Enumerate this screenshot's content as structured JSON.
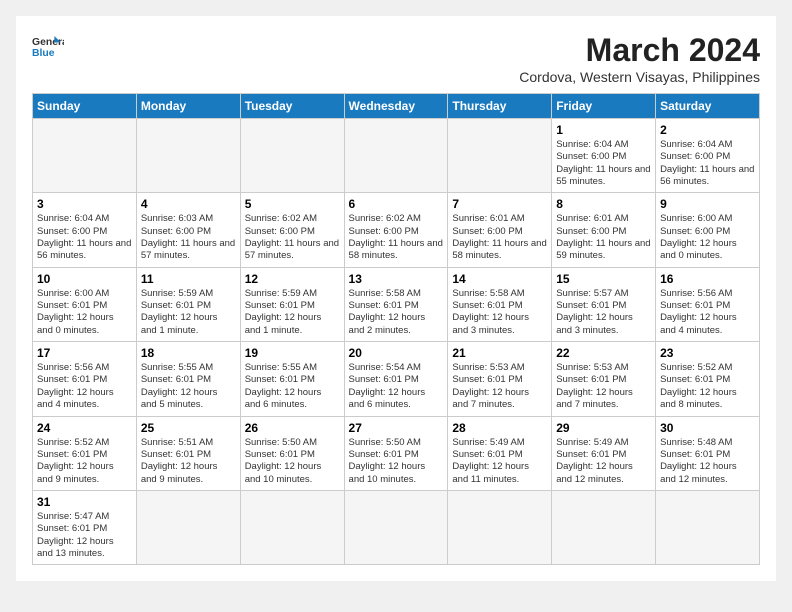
{
  "logo": {
    "line1": "General",
    "line2": "Blue"
  },
  "title": "March 2024",
  "subtitle": "Cordova, Western Visayas, Philippines",
  "weekdays": [
    "Sunday",
    "Monday",
    "Tuesday",
    "Wednesday",
    "Thursday",
    "Friday",
    "Saturday"
  ],
  "weeks": [
    [
      {
        "day": "",
        "info": ""
      },
      {
        "day": "",
        "info": ""
      },
      {
        "day": "",
        "info": ""
      },
      {
        "day": "",
        "info": ""
      },
      {
        "day": "",
        "info": ""
      },
      {
        "day": "1",
        "info": "Sunrise: 6:04 AM\nSunset: 6:00 PM\nDaylight: 11 hours and 55 minutes."
      },
      {
        "day": "2",
        "info": "Sunrise: 6:04 AM\nSunset: 6:00 PM\nDaylight: 11 hours and 56 minutes."
      }
    ],
    [
      {
        "day": "3",
        "info": "Sunrise: 6:04 AM\nSunset: 6:00 PM\nDaylight: 11 hours and 56 minutes."
      },
      {
        "day": "4",
        "info": "Sunrise: 6:03 AM\nSunset: 6:00 PM\nDaylight: 11 hours and 57 minutes."
      },
      {
        "day": "5",
        "info": "Sunrise: 6:02 AM\nSunset: 6:00 PM\nDaylight: 11 hours and 57 minutes."
      },
      {
        "day": "6",
        "info": "Sunrise: 6:02 AM\nSunset: 6:00 PM\nDaylight: 11 hours and 58 minutes."
      },
      {
        "day": "7",
        "info": "Sunrise: 6:01 AM\nSunset: 6:00 PM\nDaylight: 11 hours and 58 minutes."
      },
      {
        "day": "8",
        "info": "Sunrise: 6:01 AM\nSunset: 6:00 PM\nDaylight: 11 hours and 59 minutes."
      },
      {
        "day": "9",
        "info": "Sunrise: 6:00 AM\nSunset: 6:00 PM\nDaylight: 12 hours and 0 minutes."
      }
    ],
    [
      {
        "day": "10",
        "info": "Sunrise: 6:00 AM\nSunset: 6:01 PM\nDaylight: 12 hours and 0 minutes."
      },
      {
        "day": "11",
        "info": "Sunrise: 5:59 AM\nSunset: 6:01 PM\nDaylight: 12 hours and 1 minute."
      },
      {
        "day": "12",
        "info": "Sunrise: 5:59 AM\nSunset: 6:01 PM\nDaylight: 12 hours and 1 minute."
      },
      {
        "day": "13",
        "info": "Sunrise: 5:58 AM\nSunset: 6:01 PM\nDaylight: 12 hours and 2 minutes."
      },
      {
        "day": "14",
        "info": "Sunrise: 5:58 AM\nSunset: 6:01 PM\nDaylight: 12 hours and 3 minutes."
      },
      {
        "day": "15",
        "info": "Sunrise: 5:57 AM\nSunset: 6:01 PM\nDaylight: 12 hours and 3 minutes."
      },
      {
        "day": "16",
        "info": "Sunrise: 5:56 AM\nSunset: 6:01 PM\nDaylight: 12 hours and 4 minutes."
      }
    ],
    [
      {
        "day": "17",
        "info": "Sunrise: 5:56 AM\nSunset: 6:01 PM\nDaylight: 12 hours and 4 minutes."
      },
      {
        "day": "18",
        "info": "Sunrise: 5:55 AM\nSunset: 6:01 PM\nDaylight: 12 hours and 5 minutes."
      },
      {
        "day": "19",
        "info": "Sunrise: 5:55 AM\nSunset: 6:01 PM\nDaylight: 12 hours and 6 minutes."
      },
      {
        "day": "20",
        "info": "Sunrise: 5:54 AM\nSunset: 6:01 PM\nDaylight: 12 hours and 6 minutes."
      },
      {
        "day": "21",
        "info": "Sunrise: 5:53 AM\nSunset: 6:01 PM\nDaylight: 12 hours and 7 minutes."
      },
      {
        "day": "22",
        "info": "Sunrise: 5:53 AM\nSunset: 6:01 PM\nDaylight: 12 hours and 7 minutes."
      },
      {
        "day": "23",
        "info": "Sunrise: 5:52 AM\nSunset: 6:01 PM\nDaylight: 12 hours and 8 minutes."
      }
    ],
    [
      {
        "day": "24",
        "info": "Sunrise: 5:52 AM\nSunset: 6:01 PM\nDaylight: 12 hours and 9 minutes."
      },
      {
        "day": "25",
        "info": "Sunrise: 5:51 AM\nSunset: 6:01 PM\nDaylight: 12 hours and 9 minutes."
      },
      {
        "day": "26",
        "info": "Sunrise: 5:50 AM\nSunset: 6:01 PM\nDaylight: 12 hours and 10 minutes."
      },
      {
        "day": "27",
        "info": "Sunrise: 5:50 AM\nSunset: 6:01 PM\nDaylight: 12 hours and 10 minutes."
      },
      {
        "day": "28",
        "info": "Sunrise: 5:49 AM\nSunset: 6:01 PM\nDaylight: 12 hours and 11 minutes."
      },
      {
        "day": "29",
        "info": "Sunrise: 5:49 AM\nSunset: 6:01 PM\nDaylight: 12 hours and 12 minutes."
      },
      {
        "day": "30",
        "info": "Sunrise: 5:48 AM\nSunset: 6:01 PM\nDaylight: 12 hours and 12 minutes."
      }
    ],
    [
      {
        "day": "31",
        "info": "Sunrise: 5:47 AM\nSunset: 6:01 PM\nDaylight: 12 hours and 13 minutes."
      },
      {
        "day": "",
        "info": ""
      },
      {
        "day": "",
        "info": ""
      },
      {
        "day": "",
        "info": ""
      },
      {
        "day": "",
        "info": ""
      },
      {
        "day": "",
        "info": ""
      },
      {
        "day": "",
        "info": ""
      }
    ]
  ]
}
